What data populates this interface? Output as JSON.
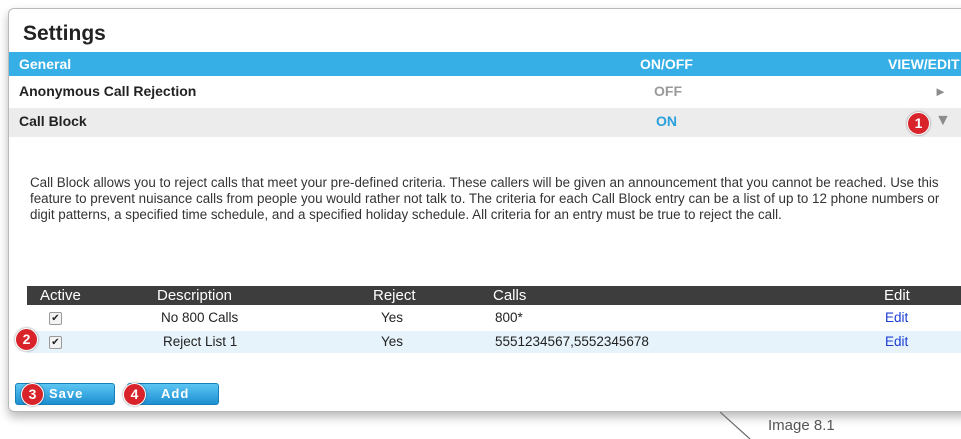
{
  "settings": {
    "title": "Settings"
  },
  "header": {
    "general": "General",
    "onoff": "ON/OFF",
    "viewedit": "VIEW/EDIT"
  },
  "rows": {
    "anon": {
      "label": "Anonymous Call Rejection",
      "state": "OFF",
      "arrow": "►"
    },
    "block": {
      "label": "Call Block",
      "state": "ON",
      "arrow": "▼"
    }
  },
  "description": "Call Block allows you to reject calls that meet your pre-defined criteria. These callers will be given an announcement that you cannot be reached. Use this feature to prevent nuisance calls from people you would rather not talk to. The criteria for each Call Block entry can be a list of up to 12 phone numbers or digit patterns, a specified time schedule, and a specified holiday schedule. All criteria for an entry must be true to reject the call.",
  "table": {
    "headers": {
      "active": "Active",
      "description": "Description",
      "reject": "Reject",
      "calls": "Calls",
      "edit": "Edit"
    },
    "rows": [
      {
        "active": "✔",
        "description": "No 800 Calls",
        "reject": "Yes",
        "calls": "800*",
        "edit": "Edit"
      },
      {
        "active": "✔",
        "description": "Reject List 1",
        "reject": "Yes",
        "calls": "5551234567,5552345678",
        "edit": "Edit"
      }
    ]
  },
  "buttons": {
    "save": "Save",
    "add": "Add"
  },
  "badges": {
    "b1": "1",
    "b2": "2",
    "b3": "3",
    "b4": "4"
  },
  "caption": "Image 8.1",
  "colors": {
    "header_blue": "#36aee6",
    "on_blue": "#2aa0dc",
    "badge_red": "#d8232a",
    "table_head": "#3d3d3d",
    "edit_link": "#1a3ed4"
  }
}
